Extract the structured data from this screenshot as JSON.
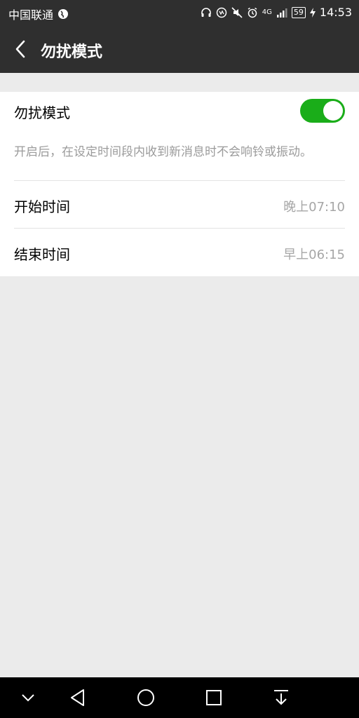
{
  "status_bar": {
    "carrier": "中国联通",
    "network": "4G",
    "battery": "59",
    "time": "14:53"
  },
  "toolbar": {
    "title": "勿扰模式"
  },
  "settings": {
    "dnd_label": "勿扰模式",
    "dnd_enabled": true,
    "description": "开启后，在设定时间段内收到新消息时不会响铃或振动。",
    "start_label": "开始时间",
    "start_value": "晚上07:10",
    "end_label": "结束时间",
    "end_value": "早上06:15"
  },
  "colors": {
    "bar": "#2f2f2f",
    "accent": "#1aad19",
    "background": "#ebebeb"
  }
}
